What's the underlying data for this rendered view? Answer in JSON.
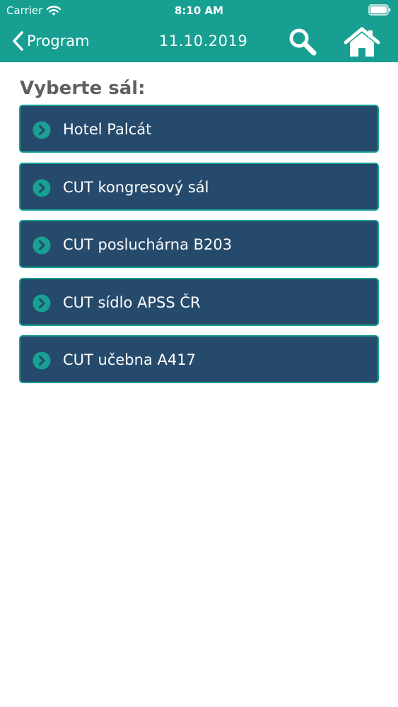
{
  "status": {
    "carrier": "Carrier",
    "time": "8:10 AM"
  },
  "navbar": {
    "back_label": "Program",
    "date": "11.10.2019"
  },
  "section_title": "Vyberte sál:",
  "halls": [
    {
      "label": "Hotel Palcát"
    },
    {
      "label": "CUT kongresový sál"
    },
    {
      "label": "CUT posluchárna B203"
    },
    {
      "label": "CUT sídlo APSS ČR"
    },
    {
      "label": "CUT učebna A417"
    }
  ],
  "colors": {
    "header": "#17a091",
    "list_item": "#264a6b",
    "accent": "#18a192",
    "title_text": "#606060"
  },
  "icons": {
    "back": "chevron-left-icon",
    "search": "search-icon",
    "home": "home-icon",
    "item": "chevron-circle-right-icon"
  }
}
